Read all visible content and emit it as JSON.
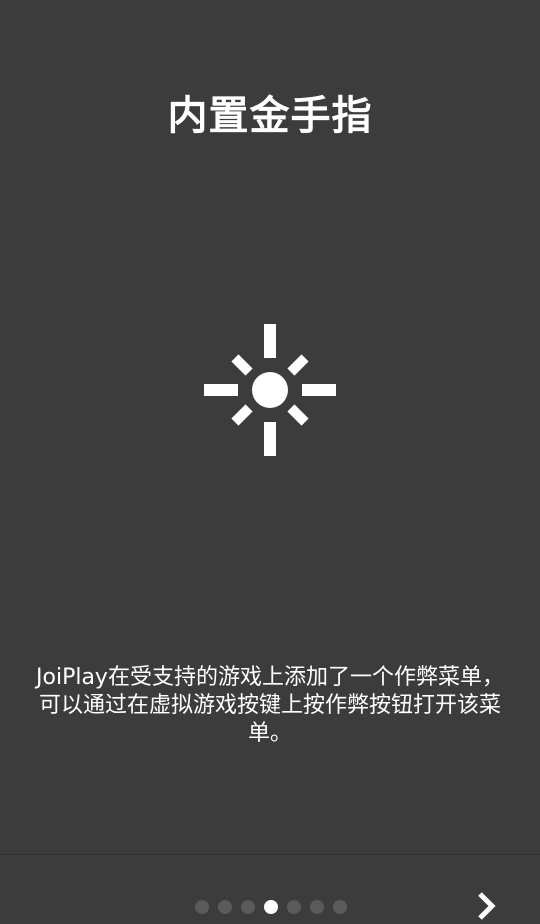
{
  "page": {
    "title": "内置金手指",
    "description": "JoiPlay在受支持的游戏上添加了一个作弊菜单，可以通过在虚拟游戏按键上按作弊按钮打开该菜单。",
    "icon": "brightness-icon"
  },
  "pager": {
    "total": 7,
    "current": 4
  },
  "nav": {
    "next_icon": "chevron-right-icon"
  },
  "colors": {
    "background": "#3c3c3c",
    "text": "#ffffff",
    "dot_inactive": "#5a5a5a",
    "dot_active": "#ffffff"
  }
}
